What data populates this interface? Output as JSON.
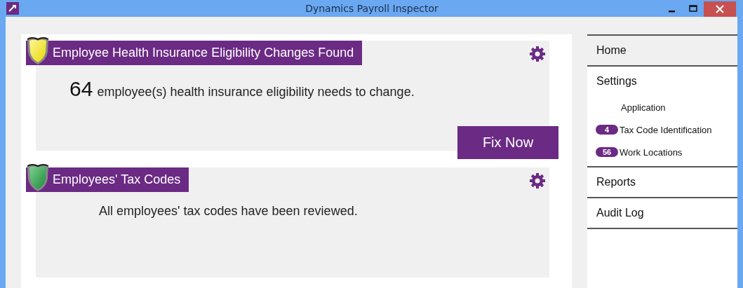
{
  "window": {
    "title": "Dynamics Payroll Inspector"
  },
  "cards": [
    {
      "title": "Employee Health Insurance Eligibility Changes Found",
      "kind": "warning",
      "count": "64",
      "message": "employee(s) health insurance eligibility needs to change.",
      "action": "Fix Now"
    },
    {
      "title": "Employees' Tax Codes",
      "kind": "ok",
      "message": "All employees' tax codes have been reviewed."
    }
  ],
  "sidebar": {
    "items": [
      {
        "label": "Home",
        "selected": true
      },
      {
        "label": "Settings",
        "selected": false,
        "children": [
          {
            "label": "Application"
          },
          {
            "label": "Tax Code Identification",
            "badge": "4"
          },
          {
            "label": "Work Locations",
            "badge": "56"
          }
        ]
      },
      {
        "label": "Reports",
        "selected": false
      },
      {
        "label": "Audit Log",
        "selected": false
      }
    ]
  }
}
